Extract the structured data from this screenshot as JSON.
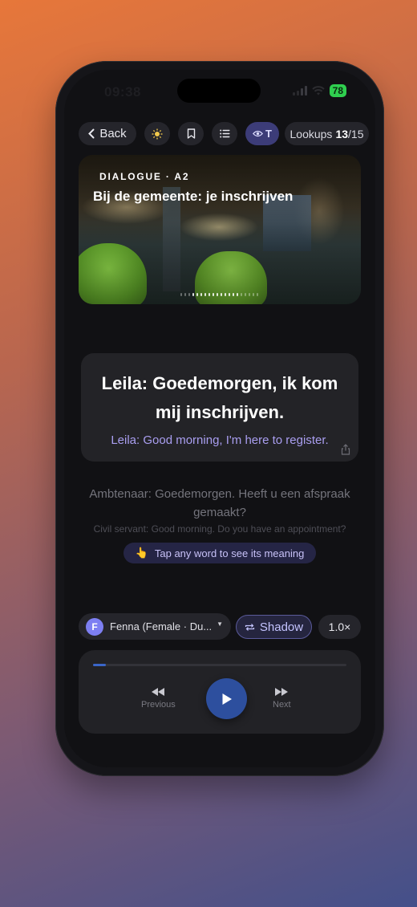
{
  "status": {
    "time": "09:38",
    "battery": "78"
  },
  "topbar": {
    "back_label": "Back",
    "eye_label": "T",
    "lookups_label": "Lookups",
    "lookups_used": "13",
    "lookups_total": "/15"
  },
  "hero": {
    "tag": "DIALOGUE · A2",
    "title": "Bij de gemeente: je inschrijven"
  },
  "current_line": {
    "dutch": "Leila: Goedemorgen, ik kom mij inschrijven.",
    "english": "Leila: Good morning, I'm here to register."
  },
  "next_line": {
    "dutch": "Ambtenaar: Goedemorgen. Heeft u een afspraak gemaakt?",
    "english": "Civil servant: Good morning. Do you have an appointment?"
  },
  "hint": {
    "icon": "👆",
    "text": "Tap any word to see its meaning"
  },
  "voice": {
    "initial": "F",
    "name": "Fenna (Female · Du..."
  },
  "controls": {
    "shadow_label": "Shadow",
    "speed_label": "1.0×"
  },
  "player": {
    "previous_label": "Previous",
    "next_label": "Next",
    "progress_fraction": 0.05
  },
  "colors": {
    "accent": "#2d4f9e",
    "translation": "#a99ef0"
  }
}
